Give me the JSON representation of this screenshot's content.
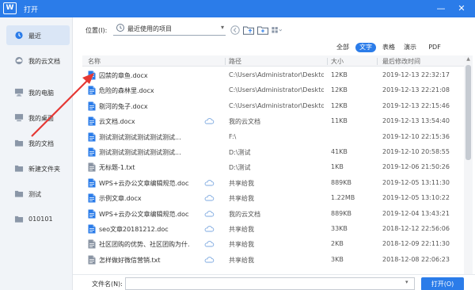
{
  "window": {
    "logo": "W",
    "title": "打开",
    "minimize": "—",
    "close": "✕",
    "accent": "#2b7ce9"
  },
  "sidebar": {
    "items": [
      {
        "label": "最近",
        "icon": "clock-icon",
        "active": true
      },
      {
        "label": "我的云文档",
        "icon": "cloud-doc-icon"
      },
      {
        "label": "我的电脑",
        "icon": "computer-icon"
      },
      {
        "label": "我的桌面",
        "icon": "desktop-icon"
      },
      {
        "label": "我的文档",
        "icon": "folder-icon"
      },
      {
        "label": "新建文件夹",
        "icon": "folder-icon"
      },
      {
        "label": "测试",
        "icon": "folder-icon"
      },
      {
        "label": "010101",
        "icon": "folder-icon"
      }
    ]
  },
  "location": {
    "label": "位置(I):",
    "value": "最近使用的项目"
  },
  "filters": [
    "全部",
    "文字",
    "表格",
    "演示",
    "PDF"
  ],
  "active_filter": "文字",
  "columns": {
    "name": "名称",
    "path": "路径",
    "size": "大小",
    "time": "最后修改时间"
  },
  "files": [
    {
      "name": "囚禁的章鱼.docx",
      "path": "C:\\Users\\Administrator\\Deskto...",
      "size": "12KB",
      "time": "2019-12-13 22:32:17",
      "cloud": false,
      "type": "docx"
    },
    {
      "name": "危险的森林里.docx",
      "path": "C:\\Users\\Administrator\\Deskto...",
      "size": "12KB",
      "time": "2019-12-13 22:21:08",
      "cloud": false,
      "type": "docx"
    },
    {
      "name": "剔河的兔子.docx",
      "path": "C:\\Users\\Administrator\\Deskto...",
      "size": "12KB",
      "time": "2019-12-13 22:15:46",
      "cloud": false,
      "type": "docx"
    },
    {
      "name": "云文档.docx",
      "path": "我的云文档",
      "size": "11KB",
      "time": "2019-12-13 13:54:40",
      "cloud": true,
      "type": "docx"
    },
    {
      "name": "测试测试测试测试测试测试...",
      "path": "F:\\",
      "size": "",
      "time": "2019-12-10 22:15:36",
      "cloud": false,
      "type": "docx"
    },
    {
      "name": "测试测试测试测试测试测试...",
      "path": "D:\\测试",
      "size": "41KB",
      "time": "2019-12-10 20:58:55",
      "cloud": false,
      "type": "docx"
    },
    {
      "name": "无标题-1.txt",
      "path": "D:\\测试",
      "size": "1KB",
      "time": "2019-12-06 21:50:26",
      "cloud": false,
      "type": "txt"
    },
    {
      "name": "WPS+云办公文章编辑规范.docx",
      "path": "共享给我",
      "size": "889KB",
      "time": "2019-12-05 13:11:30",
      "cloud": true,
      "type": "docx"
    },
    {
      "name": "示例文章.docx",
      "path": "共享给我",
      "size": "1.22MB",
      "time": "2019-12-05 13:10:22",
      "cloud": true,
      "type": "docx"
    },
    {
      "name": "WPS+云办公文章编辑规范.docx",
      "path": "我的云文档",
      "size": "889KB",
      "time": "2019-12-04 13:43:21",
      "cloud": true,
      "type": "docx"
    },
    {
      "name": "seo文章20181212.doc",
      "path": "共享给我",
      "size": "33KB",
      "time": "2018-12-12 22:56:06",
      "cloud": true,
      "type": "doc"
    },
    {
      "name": "社区团购的优势、社区团购为什...",
      "path": "共享给我",
      "size": "2KB",
      "time": "2018-12-09 22:11:30",
      "cloud": true,
      "type": "txt"
    },
    {
      "name": "怎样做好微信营销.txt",
      "path": "共享给我",
      "size": "3KB",
      "time": "2018-12-08 22:06:23",
      "cloud": true,
      "type": "txt"
    }
  ],
  "footer": {
    "filename_label": "文件名(N):",
    "filename_value": "",
    "open_button": "打开(O)"
  }
}
